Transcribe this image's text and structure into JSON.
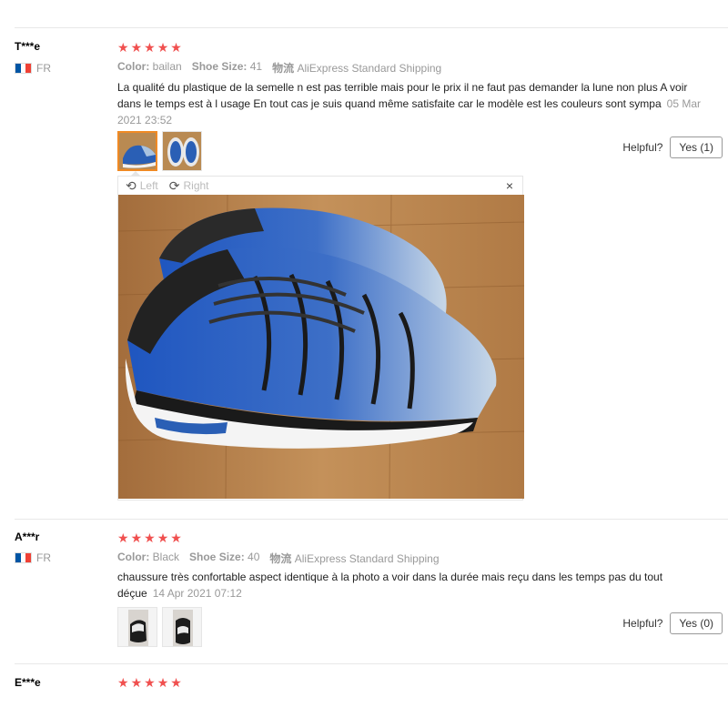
{
  "reviews": [
    {
      "user": "T***e",
      "country": "FR",
      "rating": 5,
      "color_label": "Color:",
      "color_value": "bailan",
      "size_label": "Shoe Size:",
      "size_value": "41",
      "shipping_label": "物流",
      "shipping_value": "AliExpress Standard Shipping",
      "text": "La qualité du plastique de la semelle n est pas terrible mais pour le prix il ne faut pas demander la lune non plus A voir dans le temps est à l usage En tout cas je suis quand même satisfaite car le modèle est les couleurs sont sympa",
      "date": "05 Mar 2021 23:52",
      "helpful_label": "Helpful?",
      "yes_label": "Yes (1)"
    },
    {
      "user": "A***r",
      "country": "FR",
      "rating": 5,
      "color_label": "Color:",
      "color_value": "Black",
      "size_label": "Shoe Size:",
      "size_value": "40",
      "shipping_label": "物流",
      "shipping_value": "AliExpress Standard Shipping",
      "text": "chaussure très confortable aspect identique à la photo a voir dans la durée mais reçu dans les temps pas du tout déçue",
      "date": "14 Apr 2021 07:12",
      "helpful_label": "Helpful?",
      "yes_label": "Yes (0)"
    },
    {
      "user": "E***e",
      "rating": 5
    }
  ],
  "viewer": {
    "left_label": "Left",
    "right_label": "Right",
    "close_symbol": "×"
  },
  "icons": {
    "star": "★",
    "rotate_left": "⟲",
    "rotate_right": "⟳"
  },
  "colors": {
    "star": "#f0504f",
    "flag_blue": "#0055a4",
    "flag_white": "#ffffff",
    "flag_red": "#ef4135",
    "active_thumb_border": "#f08a24"
  }
}
